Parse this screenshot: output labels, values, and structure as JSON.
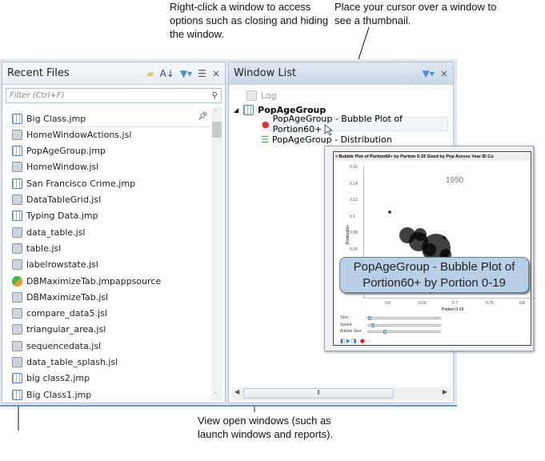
{
  "annotations": {
    "right_click": "Right-click a window to access options such as closing and hiding the window.",
    "thumbnail": "Place your cursor over a window to see a thumbnail.",
    "view_open": "View open windows (such as launch windows and reports)."
  },
  "recent_files": {
    "title": "Recent Files",
    "filter_placeholder": "Filter (Ctrl+F)",
    "items": [
      {
        "name": "Big Class.jmp",
        "type": "jmp"
      },
      {
        "name": "HomeWindowActions.jsl",
        "type": "jsl"
      },
      {
        "name": "PopAgeGroup.jmp",
        "type": "jmp"
      },
      {
        "name": "HomeWindow.jsl",
        "type": "jsl"
      },
      {
        "name": "San Francisco Crime.jmp",
        "type": "jmp"
      },
      {
        "name": "DataTableGrid.jsl",
        "type": "jsl"
      },
      {
        "name": "Typing Data.jmp",
        "type": "jmp"
      },
      {
        "name": "data_table.jsl",
        "type": "jsl"
      },
      {
        "name": "table.jsl",
        "type": "jsl"
      },
      {
        "name": "labelrowstate.jsl",
        "type": "jsl"
      },
      {
        "name": "DBMaximizeTab.jmpappsource",
        "type": "app"
      },
      {
        "name": "DBMaximizeTab.jsl",
        "type": "jsl"
      },
      {
        "name": "compare_data5.jsl",
        "type": "jsl"
      },
      {
        "name": "triangular_area.jsl",
        "type": "jsl"
      },
      {
        "name": "sequencedata.jsl",
        "type": "jsl"
      },
      {
        "name": "data_table_splash.jsl",
        "type": "jsl"
      },
      {
        "name": "big class2.jmp",
        "type": "jmp"
      },
      {
        "name": "Big Class1.jmp",
        "type": "jmp"
      }
    ]
  },
  "window_list": {
    "title": "Window List",
    "log": "Log",
    "group": "PopAgeGroup",
    "children": [
      "PopAgeGroup - Bubble Plot of Portion60+",
      "PopAgeGroup - Distribution"
    ]
  },
  "thumbnail": {
    "title": "Bubble Plot of Portion60+ by Portion 0-19 Sized by Pop Across Year ID Co",
    "year": "1950",
    "ylabel": "Portion60+",
    "xlabel": "Portion 0-19",
    "yticks": [
      "0.16",
      "0.14",
      "0.12",
      "0.1",
      "0.08",
      "0.06"
    ],
    "xticks": [
      "0.6",
      "0.65",
      "0.7",
      "0.75",
      "0.8"
    ],
    "sliders": [
      {
        "label": "Year",
        "value": 0
      },
      {
        "label": "Speed",
        "value": 0.05
      },
      {
        "label": "Bubble Size",
        "value": 0.22
      }
    ],
    "tooltip": "PopAgeGroup - Bubble Plot of Portion60+ by Portion 0-19"
  }
}
